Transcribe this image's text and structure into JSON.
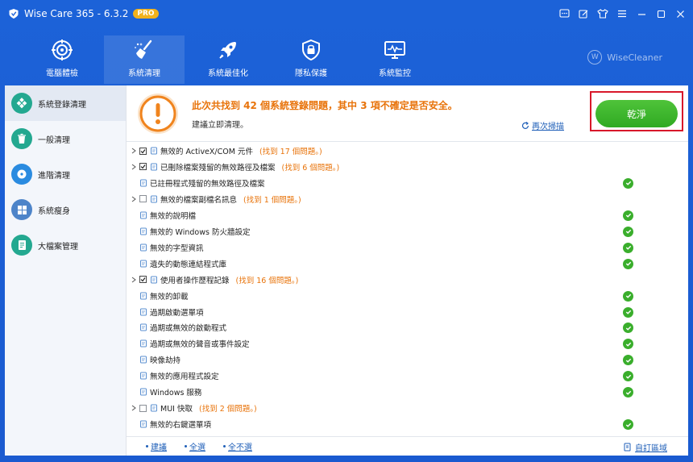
{
  "app": {
    "title": "Wise Care 365 - 6.3.2",
    "badge": "PRO",
    "brand": "WiseCleaner",
    "brand_mark": "W"
  },
  "colors": {
    "accent_blue": "#1c62d8",
    "orange": "#e8730a",
    "green": "#3aae2c",
    "highlight_red": "#d8182a"
  },
  "nav": [
    {
      "label": "電腦體檢",
      "icon": "target-icon"
    },
    {
      "label": "系統清理",
      "icon": "broom-icon"
    },
    {
      "label": "系統最佳化",
      "icon": "rocket-icon"
    },
    {
      "label": "隱私保護",
      "icon": "lock-shield-icon"
    },
    {
      "label": "系統監控",
      "icon": "monitor-icon"
    }
  ],
  "sidebar": [
    {
      "label": "系統登錄清理",
      "icon": "registry-icon",
      "color": "#23a890"
    },
    {
      "label": "一般清理",
      "icon": "trash-icon",
      "color": "#23a890"
    },
    {
      "label": "進階清理",
      "icon": "disk-icon",
      "color": "#2a8be0"
    },
    {
      "label": "系統瘦身",
      "icon": "windows-icon",
      "color": "#4d84c9"
    },
    {
      "label": "大檔案管理",
      "icon": "file-list-icon",
      "color": "#23a890"
    }
  ],
  "summary": {
    "title": "此次共找到 42 個系統登錄問題，其中 3 項不確定是否安全。",
    "subtitle": "建議立即清理。",
    "rescan": "再次掃描",
    "clean_button": "乾淨"
  },
  "items": [
    {
      "label": "無效的 ActiveX/COM 元件",
      "found": "(找到 17 個問題。)",
      "level": "top",
      "expand": true,
      "checkbox": "checked",
      "ok": false,
      "icon": "puzzle-icon"
    },
    {
      "label": "已刪除檔案殘留的無效路徑及檔案",
      "found": "(找到 6 個問題。)",
      "level": "top",
      "expand": true,
      "checkbox": "checked",
      "ok": false,
      "icon": "folder-icon"
    },
    {
      "label": "已註冊程式殘留的無效路徑及檔案",
      "found": "",
      "level": "sub",
      "expand": false,
      "checkbox": "none",
      "ok": true,
      "icon": "document-icon"
    },
    {
      "label": "無效的檔案副檔名訊息",
      "found": "(找到 1 個問題。)",
      "level": "top",
      "expand": true,
      "checkbox": "unchecked",
      "ok": false,
      "icon": "document-icon"
    },
    {
      "label": "無效的說明檔",
      "found": "",
      "level": "sub",
      "expand": false,
      "checkbox": "none",
      "ok": true,
      "icon": "help-file-icon"
    },
    {
      "label": "無效的 Windows 防火牆設定",
      "found": "",
      "level": "sub",
      "expand": false,
      "checkbox": "none",
      "ok": true,
      "icon": "firewall-icon"
    },
    {
      "label": "無效的字型資訊",
      "found": "",
      "level": "sub",
      "expand": false,
      "checkbox": "none",
      "ok": true,
      "icon": "font-icon"
    },
    {
      "label": "遺失的動態連結程式庫",
      "found": "",
      "level": "sub",
      "expand": false,
      "checkbox": "none",
      "ok": true,
      "icon": "link-icon"
    },
    {
      "label": "使用者操作歷程記錄",
      "found": "(找到 16 個問題。)",
      "level": "top",
      "expand": true,
      "checkbox": "checked",
      "ok": false,
      "icon": "history-icon"
    },
    {
      "label": "無效的卸載",
      "found": "",
      "level": "sub",
      "expand": false,
      "checkbox": "none",
      "ok": true,
      "icon": "uninstall-icon"
    },
    {
      "label": "過期啟動選單項",
      "found": "",
      "level": "sub",
      "expand": false,
      "checkbox": "none",
      "ok": true,
      "icon": "menu-icon"
    },
    {
      "label": "過期或無效的啟動程式",
      "found": "",
      "level": "sub",
      "expand": false,
      "checkbox": "none",
      "ok": true,
      "icon": "startup-icon"
    },
    {
      "label": "過期或無效的聲音或事件設定",
      "found": "",
      "level": "sub",
      "expand": false,
      "checkbox": "none",
      "ok": true,
      "icon": "speaker-icon"
    },
    {
      "label": "映像劫持",
      "found": "",
      "level": "sub",
      "expand": false,
      "checkbox": "none",
      "ok": true,
      "icon": "bug-icon"
    },
    {
      "label": "無效的應用程式設定",
      "found": "",
      "level": "sub",
      "expand": false,
      "checkbox": "none",
      "ok": true,
      "icon": "settings-icon"
    },
    {
      "label": "Windows 服務",
      "found": "",
      "level": "sub",
      "expand": false,
      "checkbox": "none",
      "ok": true,
      "icon": "services-icon"
    },
    {
      "label": "MUI 快取",
      "found": "(找到 2 個問題。)",
      "level": "top",
      "expand": true,
      "checkbox": "unchecked",
      "ok": false,
      "icon": "cache-icon"
    },
    {
      "label": "無效的右鍵選單項",
      "found": "",
      "level": "sub",
      "expand": false,
      "checkbox": "none",
      "ok": true,
      "icon": "mouse-icon"
    }
  ],
  "footer": {
    "recommend": "建議",
    "select_all": "全選",
    "select_none": "全不選",
    "custom_area": "自訂區域"
  }
}
